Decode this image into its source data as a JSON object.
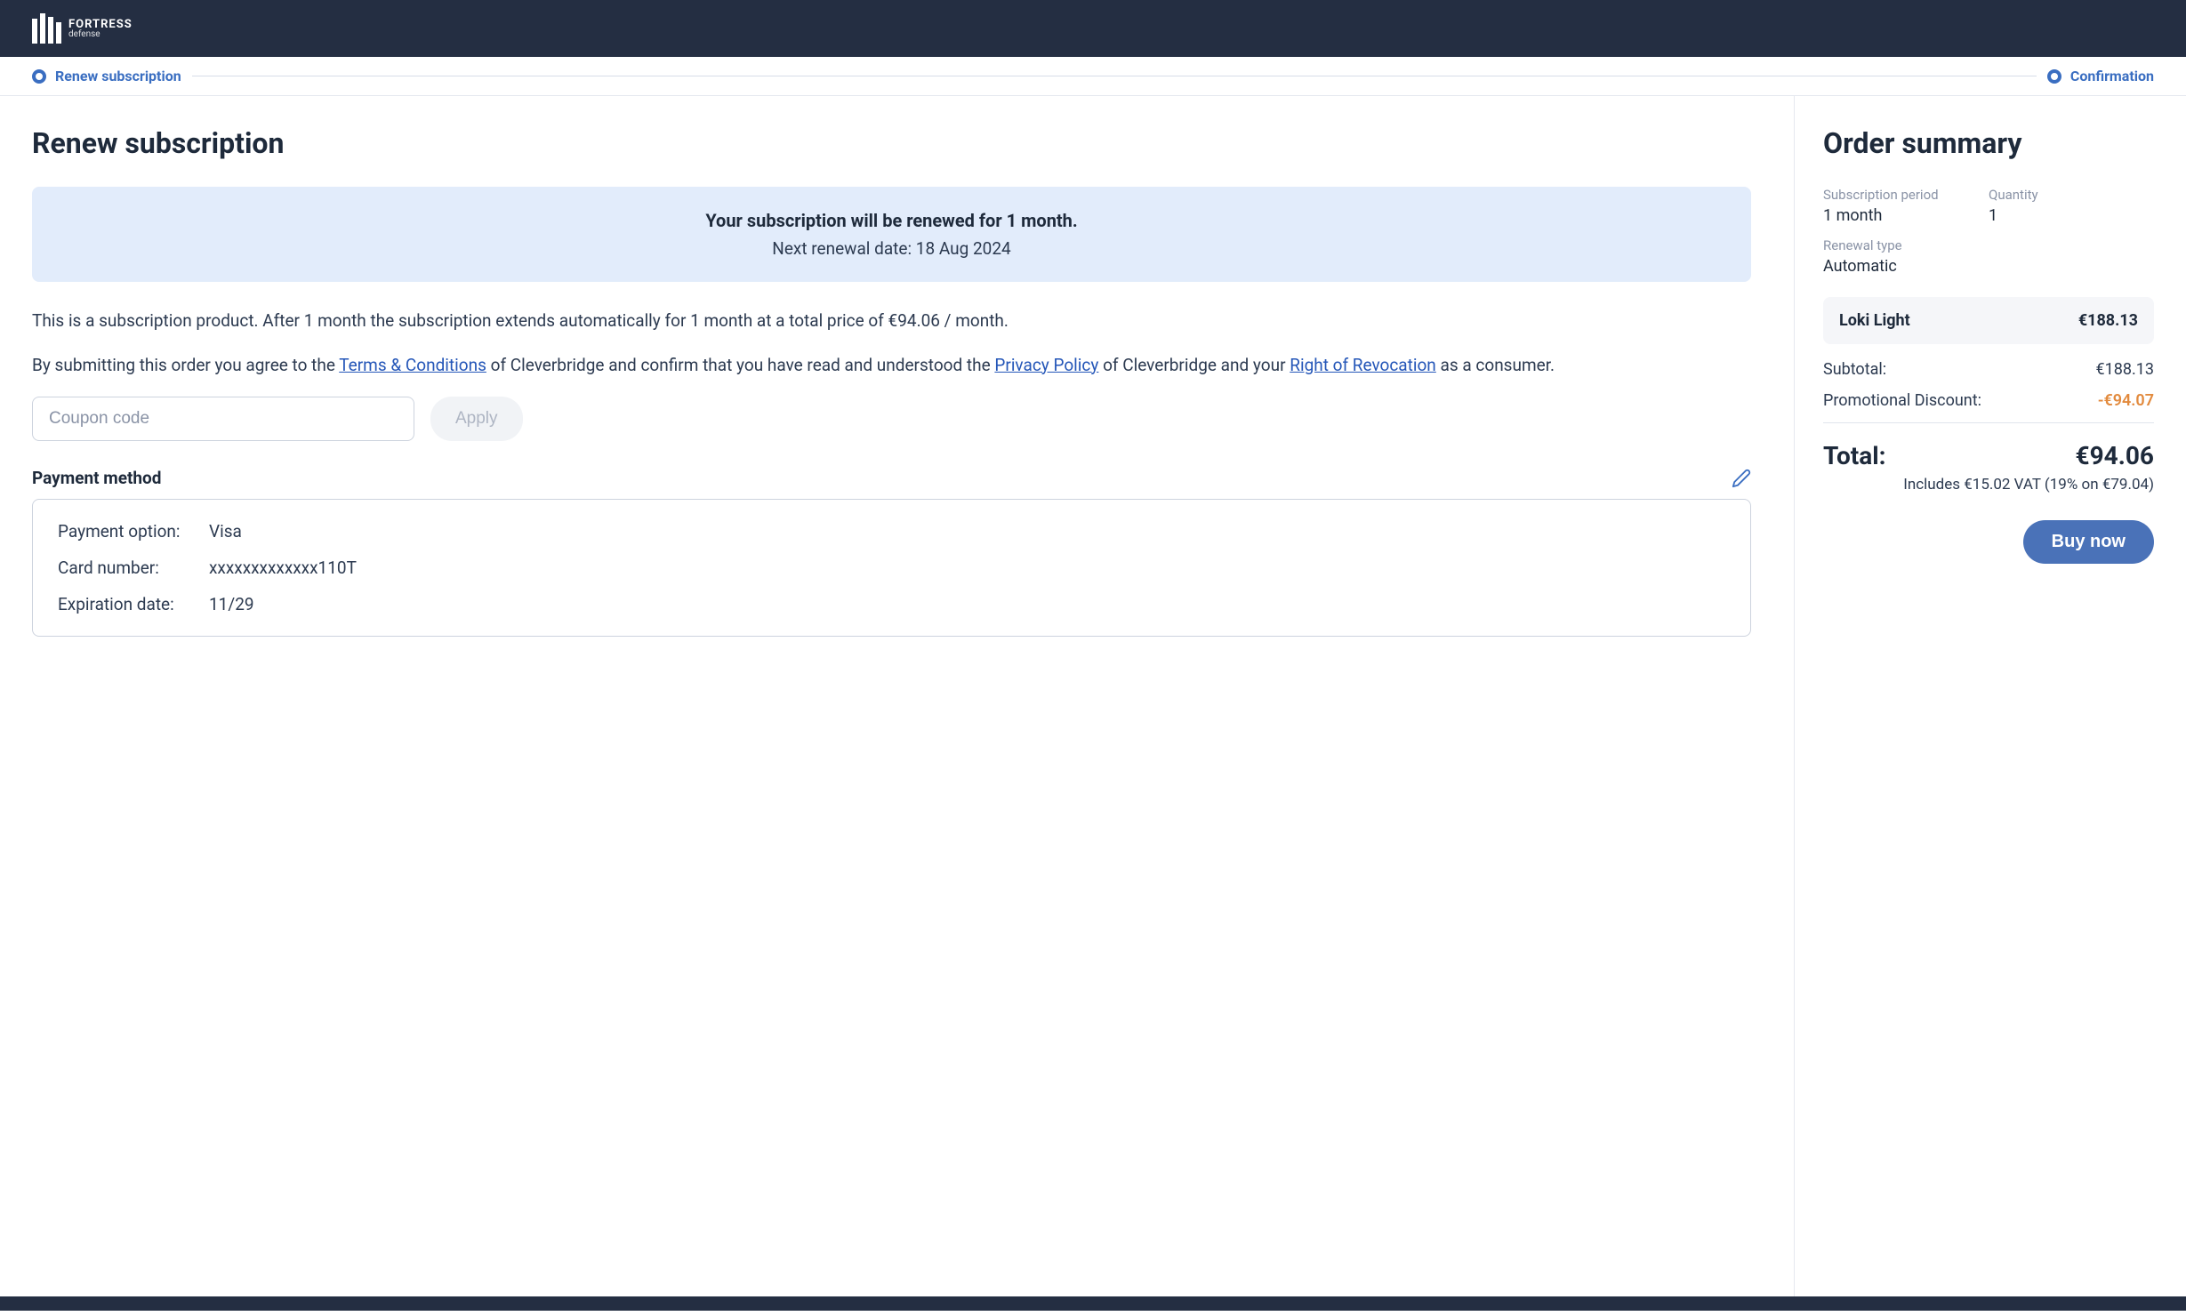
{
  "brand": {
    "name": "FORTRESS",
    "sub": "defense"
  },
  "steps": {
    "renew": "Renew subscription",
    "confirmation": "Confirmation"
  },
  "main": {
    "title": "Renew subscription",
    "info_line1": "Your subscription will be renewed for 1 month.",
    "info_line2": "Next renewal date: 18 Aug 2024",
    "desc": "This is a subscription product. After 1 month the subscription extends automatically for 1 month at a total price of €94.06 / month.",
    "terms_prefix": "By submitting this order you agree to the ",
    "terms_link": "Terms & Conditions",
    "terms_mid1": " of Cleverbridge and confirm that you have read and understood the ",
    "privacy_link": "Privacy Policy",
    "terms_mid2": " of Cleverbridge and your ",
    "revocation_link": "Right of Revocation",
    "terms_suffix": " as a consumer.",
    "coupon_placeholder": "Coupon code",
    "apply_label": "Apply",
    "payment_method_title": "Payment method",
    "payment": {
      "option_label": "Payment option:",
      "option_value": "Visa",
      "card_label": "Card number:",
      "card_value": "xxxxxxxxxxxxx110T",
      "exp_label": "Expiration date:",
      "exp_value": "11/29"
    }
  },
  "summary": {
    "title": "Order summary",
    "period_label": "Subscription period",
    "period_value": "1 month",
    "qty_label": "Quantity",
    "qty_value": "1",
    "renewal_label": "Renewal type",
    "renewal_value": "Automatic",
    "product_name": "Loki Light",
    "product_price": "€188.13",
    "subtotal_label": "Subtotal:",
    "subtotal_value": "€188.13",
    "discount_label": "Promotional Discount:",
    "discount_value": "-€94.07",
    "total_label": "Total:",
    "total_value": "€94.06",
    "vat_text": "Includes €15.02 VAT (19% on €79.04)",
    "buy_label": "Buy now"
  }
}
